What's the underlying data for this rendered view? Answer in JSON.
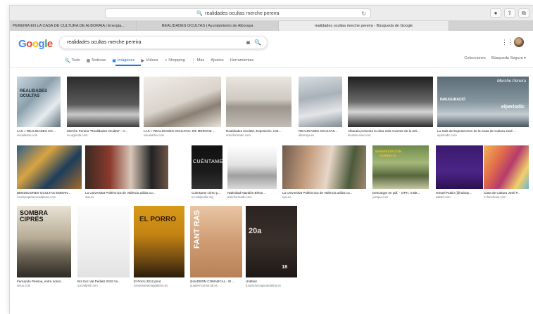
{
  "browser": {
    "address": "realidades ocultas merche pereira",
    "tabs": [
      "PEREIRA EN LA CASA DE CULTURA DE ALBORAIA | Energia...",
      "REALIDADES OCULTAS | Ayuntamiento de Alboraya",
      "realidades ocultas merche pereira - Búsqueda de Google",
      ""
    ]
  },
  "google": {
    "logo": [
      {
        "ch": "G",
        "color": "#4285F4"
      },
      {
        "ch": "o",
        "color": "#EA4335"
      },
      {
        "ch": "o",
        "color": "#FBBC05"
      },
      {
        "ch": "g",
        "color": "#4285F4"
      },
      {
        "ch": "l",
        "color": "#34A853"
      },
      {
        "ch": "e",
        "color": "#EA4335"
      }
    ],
    "query": "realidades ocultas merche pereira",
    "nav": [
      {
        "label": "Todo",
        "icon": "search-icon",
        "glyph": "🔍"
      },
      {
        "label": "Noticias",
        "icon": "news-icon",
        "glyph": "▦"
      },
      {
        "label": "Imágenes",
        "icon": "images-icon",
        "glyph": "▣"
      },
      {
        "label": "Vídeos",
        "icon": "video-icon",
        "glyph": "▶"
      },
      {
        "label": "Shopping",
        "icon": "tag-icon",
        "glyph": "⌂"
      },
      {
        "label": "Más",
        "icon": "more-icon",
        "glyph": "⋮"
      },
      {
        "label": "Ajustes",
        "icon": "",
        "glyph": ""
      },
      {
        "label": "Herramientas",
        "icon": "",
        "glyph": ""
      }
    ],
    "nav_right": [
      "Colecciones",
      "Búsqueda Segura ▾"
    ],
    "accent": "#1a73e8"
  },
  "results": [
    {
      "caption": "LAS « REALIDADES OC...",
      "source": "visualartxv.com",
      "bg": "linear-gradient(135deg,#c9d6de,#8aa0ad 40%,#e7ecef 70%,#5c6f7b)"
    },
    {
      "caption": "Merche Pereira \"Realidades Ocultas\" - A...",
      "source": "av-agenda.com",
      "bg": "linear-gradient(180deg,#2b2b2b,#5a5a5a 55%,#c9c9c9 75%,#3d3d3d)"
    },
    {
      "caption": "LAS « REALIDADES OCULTAS» DE MERCHE ...",
      "source": "visualartxv.com",
      "bg": "linear-gradient(160deg,#f1eee9,#d9d3cb 50%,#8a7f72 70%,#e9e4de)"
    },
    {
      "caption": "Realidades Ocultas, Exposición, Inst...",
      "source": "artenformado.com",
      "bg": "linear-gradient(180deg,#e9e6e0,#cfcac2 45%,#9b958c 60%,#c2bdb5)"
    },
    {
      "caption": "REALIDADES OCULTAS...",
      "source": "alboraya.es",
      "bg": "linear-gradient(170deg,#d7dde2,#a9b2b9 40%,#e3e6e9 70%,#7f8a92)"
    },
    {
      "caption": "Alboraia presenta la obra más reciente de la arti...",
      "source": "levante-emv.com",
      "bg": "linear-gradient(180deg,#1e1e1e,#6a6a6a 50%,#d6d6d6 70%,#2a2a2a)"
    },
    {
      "caption": "La Sala de Exposiciones de la Casa de Cultura José ...",
      "source": "elperiodic.com",
      "bg": "linear-gradient(180deg,#5b6c77,#8797a0 50%,#c4cdd2 75%,#46555e)"
    },
    {
      "caption": "BENDICIONES OCULTAS EMMAN...",
      "source": "mcsinespirita.wordpress.com",
      "bg": "linear-gradient(135deg,#2f5d8a,#d9a441 35%,#1d3d5c 65%,#a46b2a)"
    },
    {
      "caption": "La Universitat Politècnica de València utiliza co...",
      "source": "upv.es",
      "bg": "linear-gradient(90deg,#3a2a22,#8c3a2c 30%,#d7c7b8 55%,#222 80%,#6e5648)"
    },
    {
      "caption": "Cuéntame cómo pasó - Wi...",
      "source": "es.wikipedia.org",
      "bg": "linear-gradient(180deg,#111,#1b1b1b 60%,#333)"
    },
    {
      "caption": "Natividad Navalón Blesa ...",
      "source": "artenformado.com",
      "bg": "linear-gradient(180deg,#ffffff,#e2e2e2 45%,#9f9f9f 70%,#dadada)"
    },
    {
      "caption": "La Universitat Politècnica de València utiliza co...",
      "source": "upv.es",
      "bg": "linear-gradient(100deg,#6d5b4d,#c39b7c 30%,#e8d6c6 55%,#4b5a3a 80%,#a3886f)"
    },
    {
      "caption": "Descargar en pdf. - IAPH. Instit...",
      "source": "yumpu.com",
      "bg": "linear-gradient(180deg,#6e8a4a,#a4b878 40%,#57663d 70%,#c5c7a2)"
    },
    {
      "caption": "Ismael Rubio (@rubiop...",
      "source": "twitter.com",
      "bg": "linear-gradient(180deg,#3b1a6e,#4d2487 60%,#2a1150)"
    },
    {
      "caption": "Casa de Cultura José P...",
      "source": "m.facebook.com",
      "bg": "linear-gradient(120deg,#f0b35a,#e3714a 30%,#b63b6c 55%,#f2d06b 80%,#6fb3c9)"
    },
    {
      "caption": "Fernando Pessoa, entre nosot...",
      "source": "issuu.com",
      "bg": "linear-gradient(180deg,#e9e3d5,#b7ab95 45%,#6b6354 70%,#2d2a25)"
    },
    {
      "caption": "Bol Soc Val Pediatr 2019 Vo...",
      "source": "socvalped.com",
      "bg": "linear-gradient(180deg,#fbfbfb,#efefef 60%,#e2e2e2)"
    },
    {
      "caption": "El Porro 2012.pmd",
      "source": "santamariamagdalena.es",
      "bg": "linear-gradient(180deg,#d79a1a,#c48312 40%,#6f4a12 75%,#2a1c0b)"
    },
    {
      "caption": "QUADERN COMARCAL - El ...",
      "source": "quaderncomarcal.es",
      "bg": "linear-gradient(180deg,#e9c6a4,#cf9c73 50%,#b88157)"
    },
    {
      "caption": "Untitled",
      "source": "fundacioncajacantabria.es",
      "bg": "linear-gradient(180deg,#2a2320,#3a302b 50%,#1d1816)"
    }
  ],
  "overlay_texts": {
    "r1": "REALIDADES OCULTAS",
    "r7a": "Merche Pereira",
    "r7b": "INAUGURACIÓ",
    "r7c": "elperiodic",
    "r10": "CUÉNTAME",
    "r14a": "MANIFESTACIÓN",
    "r14b": "FEMINISTA",
    "r16": "SOMBRA CIPRÉS",
    "r18": "EL PORRO",
    "r19": "FANT RAS",
    "r20a": "20a",
    "r20b": "18"
  }
}
